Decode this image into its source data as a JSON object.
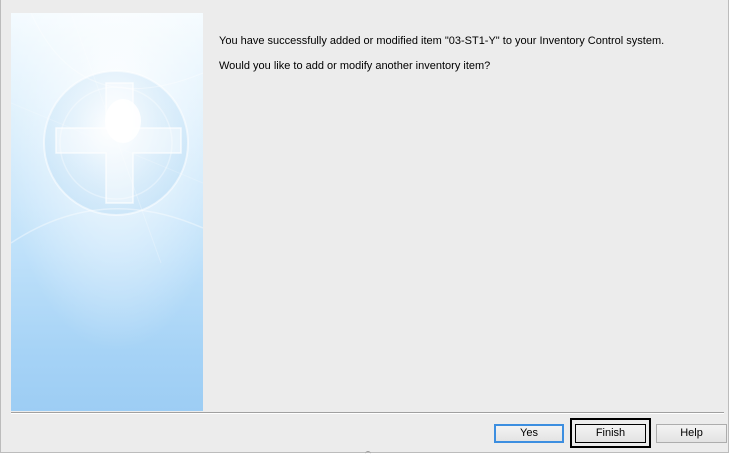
{
  "dialog": {
    "message_line_1": "You have successfully added or modified item \"03-ST1-Y\" to your Inventory Control system.",
    "message_line_2": "Would you like to add or modify another inventory item?"
  },
  "buttons": {
    "yes_label": "Yes",
    "finish_label": "Finish",
    "help_label": "Help"
  },
  "icons": {
    "side_image": "wizard-sphere-graphic"
  },
  "colors": {
    "window_background": "#ececec",
    "side_image_top": "#f4fbff",
    "side_image_bottom": "#9dcdf4",
    "default_button_focus": "#3c8ee0",
    "highlight_frame": "#000000"
  }
}
